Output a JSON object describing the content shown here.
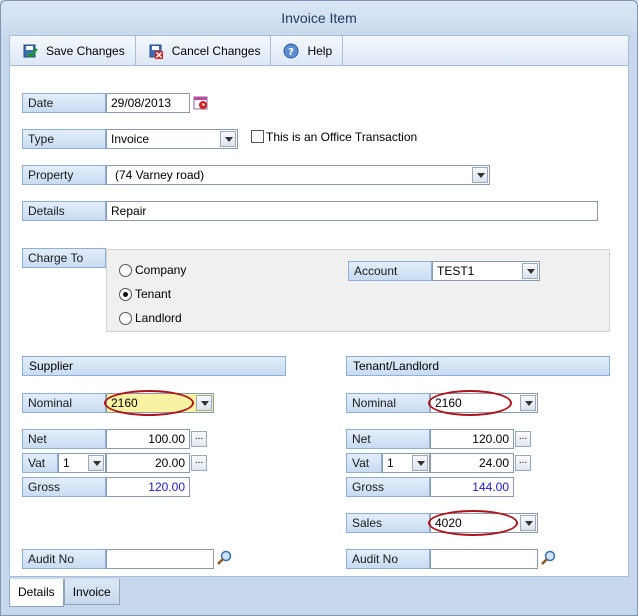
{
  "window": {
    "title": "Invoice Item"
  },
  "toolbar": {
    "save_label": "Save Changes",
    "cancel_label": "Cancel Changes",
    "help_label": "Help"
  },
  "form": {
    "date_label": "Date",
    "date_value": "29/08/2013",
    "type_label": "Type",
    "type_value": "Invoice",
    "office_label": "This is an Office Transaction",
    "property_label": "Property",
    "property_value": "(74 Varney road)",
    "details_label": "Details",
    "details_value": "Repair",
    "charge_to_label": "Charge To",
    "charge_options": [
      "Company",
      "Tenant",
      "Landlord"
    ],
    "charge_selected": "Tenant",
    "account_label": "Account",
    "account_value": "TEST1"
  },
  "supplier": {
    "header": "Supplier",
    "nominal_label": "Nominal",
    "nominal_value": "2160",
    "net_label": "Net",
    "net_value": "100.00",
    "vat_label": "Vat",
    "vat_code": "1",
    "vat_value": "20.00",
    "gross_label": "Gross",
    "gross_value": "120.00",
    "audit_label": "Audit No",
    "audit_value": ""
  },
  "tenant": {
    "header": "Tenant/Landlord",
    "nominal_label": "Nominal",
    "nominal_value": "2160",
    "net_label": "Net",
    "net_value": "120.00",
    "vat_label": "Vat",
    "vat_code": "1",
    "vat_value": "24.00",
    "gross_label": "Gross",
    "gross_value": "144.00",
    "sales_label": "Sales",
    "sales_value": "4020",
    "audit_label": "Audit No",
    "audit_value": ""
  },
  "tabs": [
    "Details",
    "Invoice"
  ],
  "colors": {
    "accent_label_bg": "#c9dcf2",
    "highlight_ellipse": "#b0121b",
    "gross_text": "#1a1ad6",
    "nominal_highlight": "#f8f3a3"
  }
}
